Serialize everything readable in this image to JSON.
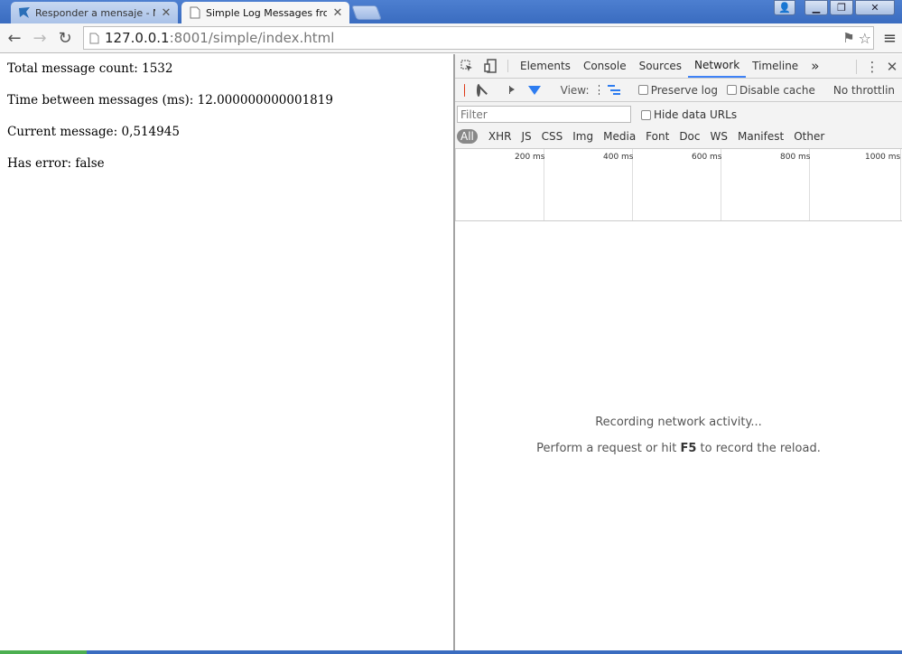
{
  "tabs": [
    {
      "title": "Responder a mensaje - NI C",
      "close": "✕"
    },
    {
      "title": "Simple Log Messages from Se",
      "close": "✕"
    }
  ],
  "window_buttons": {
    "profile": "👤",
    "minimize": "▁",
    "restore": "❐",
    "close": "✕"
  },
  "toolbar": {
    "back": "←",
    "forward": "→",
    "reload": "↻",
    "url_host": "127.0.0.1",
    "url_path": ":8001/simple/index.html",
    "translate": "⚑",
    "star": "☆",
    "menu": "≡"
  },
  "page": {
    "total_count": "Total message count: 1532",
    "time_between": "Time between messages (ms): 12.000000000001819",
    "current_message": "Current message: 0,514945",
    "has_error": "Has error: false"
  },
  "devtools": {
    "tabs": [
      "Elements",
      "Console",
      "Sources",
      "Network",
      "Timeline"
    ],
    "selected_tab": "Network",
    "more": "»",
    "kebab": "⋮",
    "close": "✕",
    "view_label": "View:",
    "preserve_log": "Preserve log",
    "disable_cache": "Disable cache",
    "throttling": "No throttlin",
    "filter_placeholder": "Filter",
    "hide_data_urls": "Hide data URLs",
    "types": [
      "All",
      "XHR",
      "JS",
      "CSS",
      "Img",
      "Media",
      "Font",
      "Doc",
      "WS",
      "Manifest",
      "Other"
    ],
    "timeline_labels": [
      "200 ms",
      "400 ms",
      "600 ms",
      "800 ms",
      "1000 ms"
    ],
    "empty_line1": "Recording network activity...",
    "empty_line2_prefix": "Perform a request or hit ",
    "empty_line2_key": "F5",
    "empty_line2_suffix": " to record the reload."
  },
  "colors": {
    "record": "#dd1111",
    "accent": "#3e82f7",
    "titlebar": "#3a6cc0"
  }
}
